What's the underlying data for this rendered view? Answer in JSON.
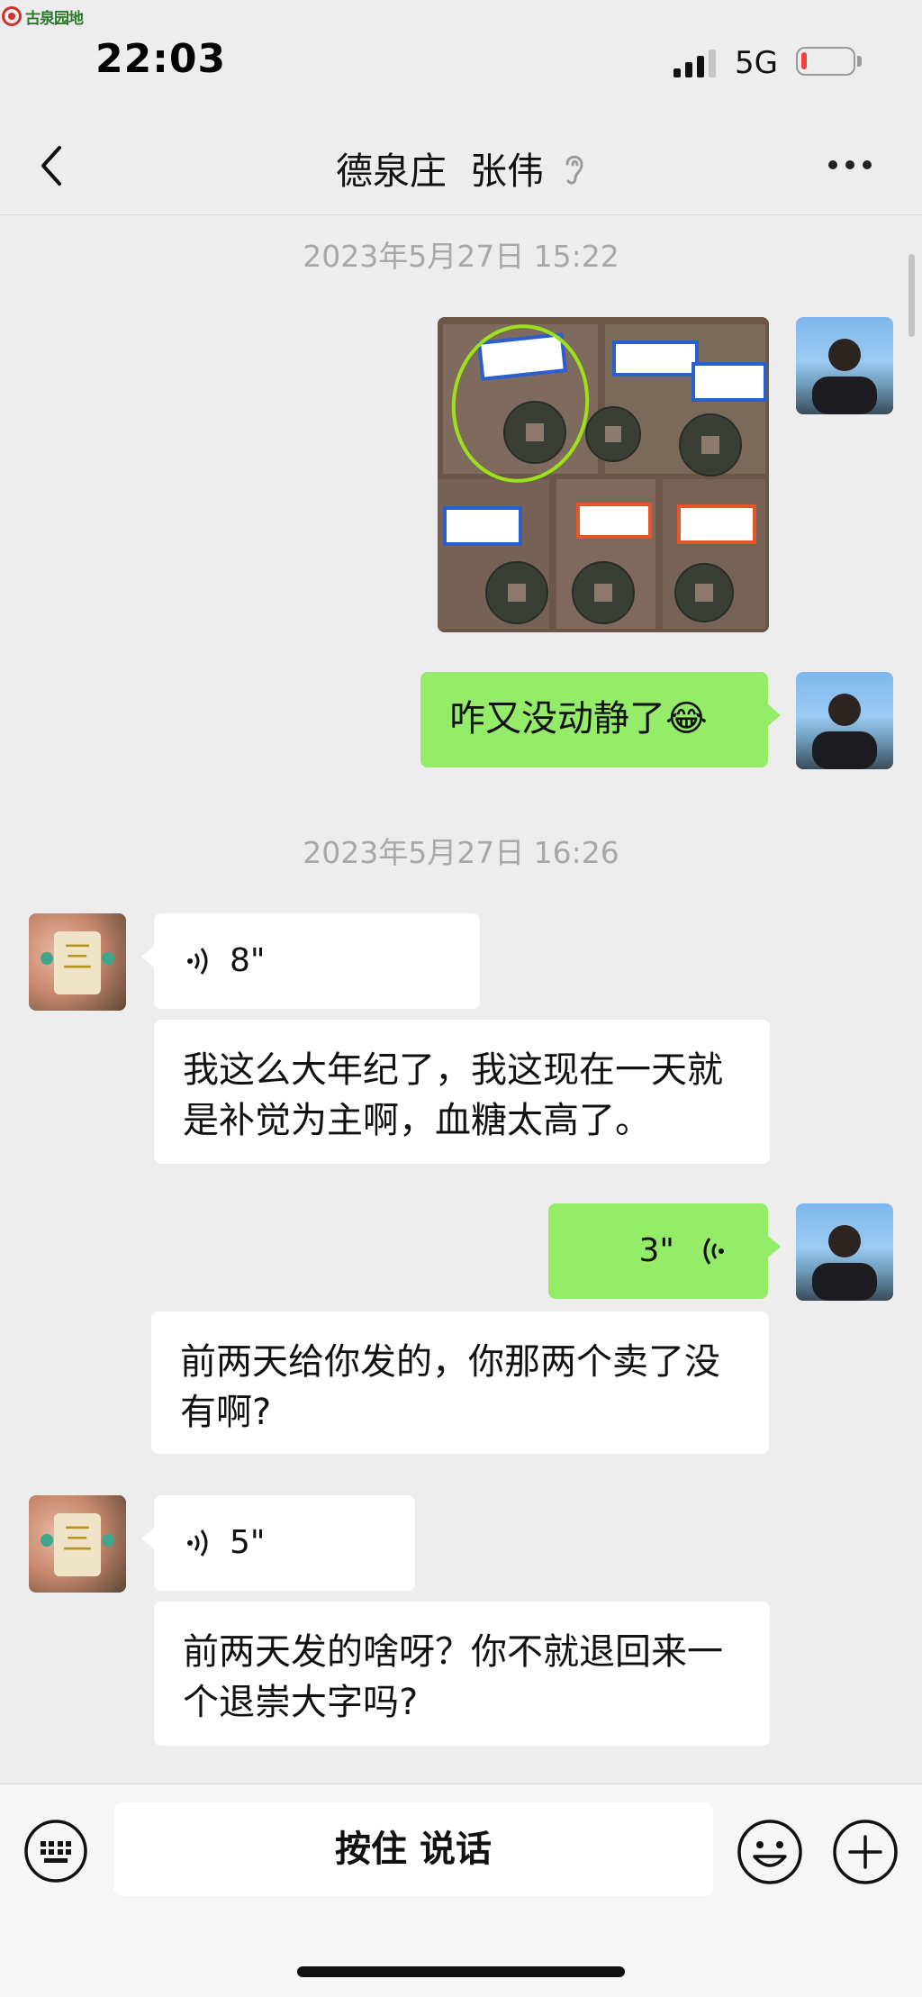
{
  "watermark": {
    "text": "古泉园地",
    "icon": "watermark-logo"
  },
  "status_bar": {
    "time": "22:03",
    "network": "5G",
    "signal_bars": 3,
    "battery_level": 0.1,
    "battery_color": "#f2403f"
  },
  "nav": {
    "title": "德泉庄  张伟",
    "back_icon": "chevron-left-icon",
    "mode_icon": "ear-icon",
    "more_icon": "more-icon"
  },
  "colors": {
    "background": "#ededed",
    "my_bubble": "#95ec69",
    "their_bubble": "#ffffff",
    "timestamp": "#a8a8a8"
  },
  "messages": {
    "ts1": "2023年5月27日 15:22",
    "m2": "咋又没动静了😂",
    "ts2": "2023年5月27日 16:26",
    "v1": "8\"",
    "t1": "我这么大年纪了，我这现在一天就是补觉为主啊，血糖太高了。",
    "v2": "3\"",
    "t2": "前两天给你发的，你那两个卖了没有啊?",
    "v3": "5\"",
    "t3": "前两天发的啥呀？你不就退回来一个退崇大字吗?"
  },
  "bottom_bar": {
    "talk_label": "按住 说话",
    "keyboard_icon": "keyboard-icon",
    "emoji_icon": "emoji-icon",
    "plus_icon": "plus-icon"
  }
}
